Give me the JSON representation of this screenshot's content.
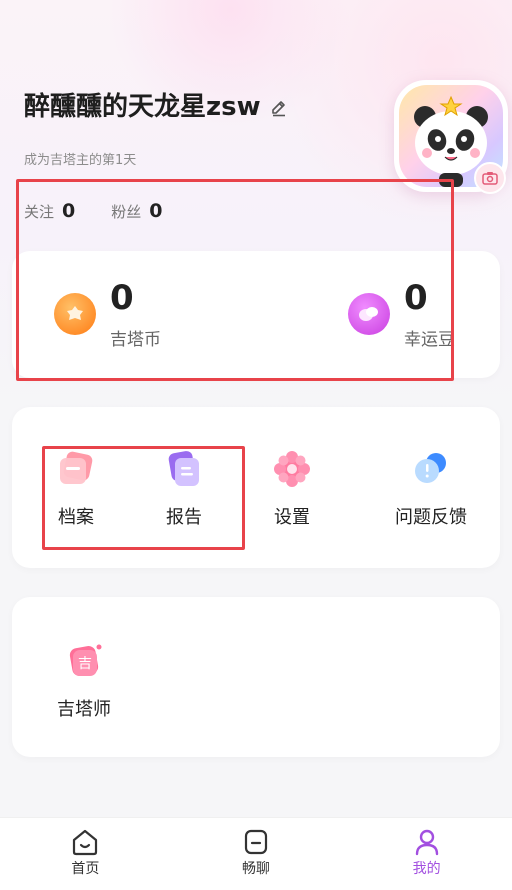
{
  "profile": {
    "name": "醉醺醺的天龙星zsw",
    "since": "成为吉塔主的第1天",
    "follow_label": "关注",
    "follow_count": "0",
    "fans_label": "粉丝",
    "fans_count": "0"
  },
  "balance": {
    "coin_value": "0",
    "coin_label": "吉塔币",
    "bean_value": "0",
    "bean_label": "幸运豆"
  },
  "menu": {
    "items": [
      {
        "label": "档案",
        "icon": "archive-icon"
      },
      {
        "label": "报告",
        "icon": "report-icon"
      },
      {
        "label": "设置",
        "icon": "settings-icon"
      },
      {
        "label": "问题反馈",
        "icon": "feedback-icon"
      }
    ]
  },
  "master": {
    "label": "吉塔师",
    "icon_char": "吉"
  },
  "tabbar": {
    "items": [
      {
        "label": "首页",
        "icon": "home-icon"
      },
      {
        "label": "畅聊",
        "icon": "chat-icon"
      },
      {
        "label": "我的",
        "icon": "profile-icon"
      }
    ]
  },
  "colors": {
    "accent": "#a24fe0",
    "highlight": "#e8434a",
    "coin": "#ff8a1e",
    "bean": "#d84ce8"
  }
}
